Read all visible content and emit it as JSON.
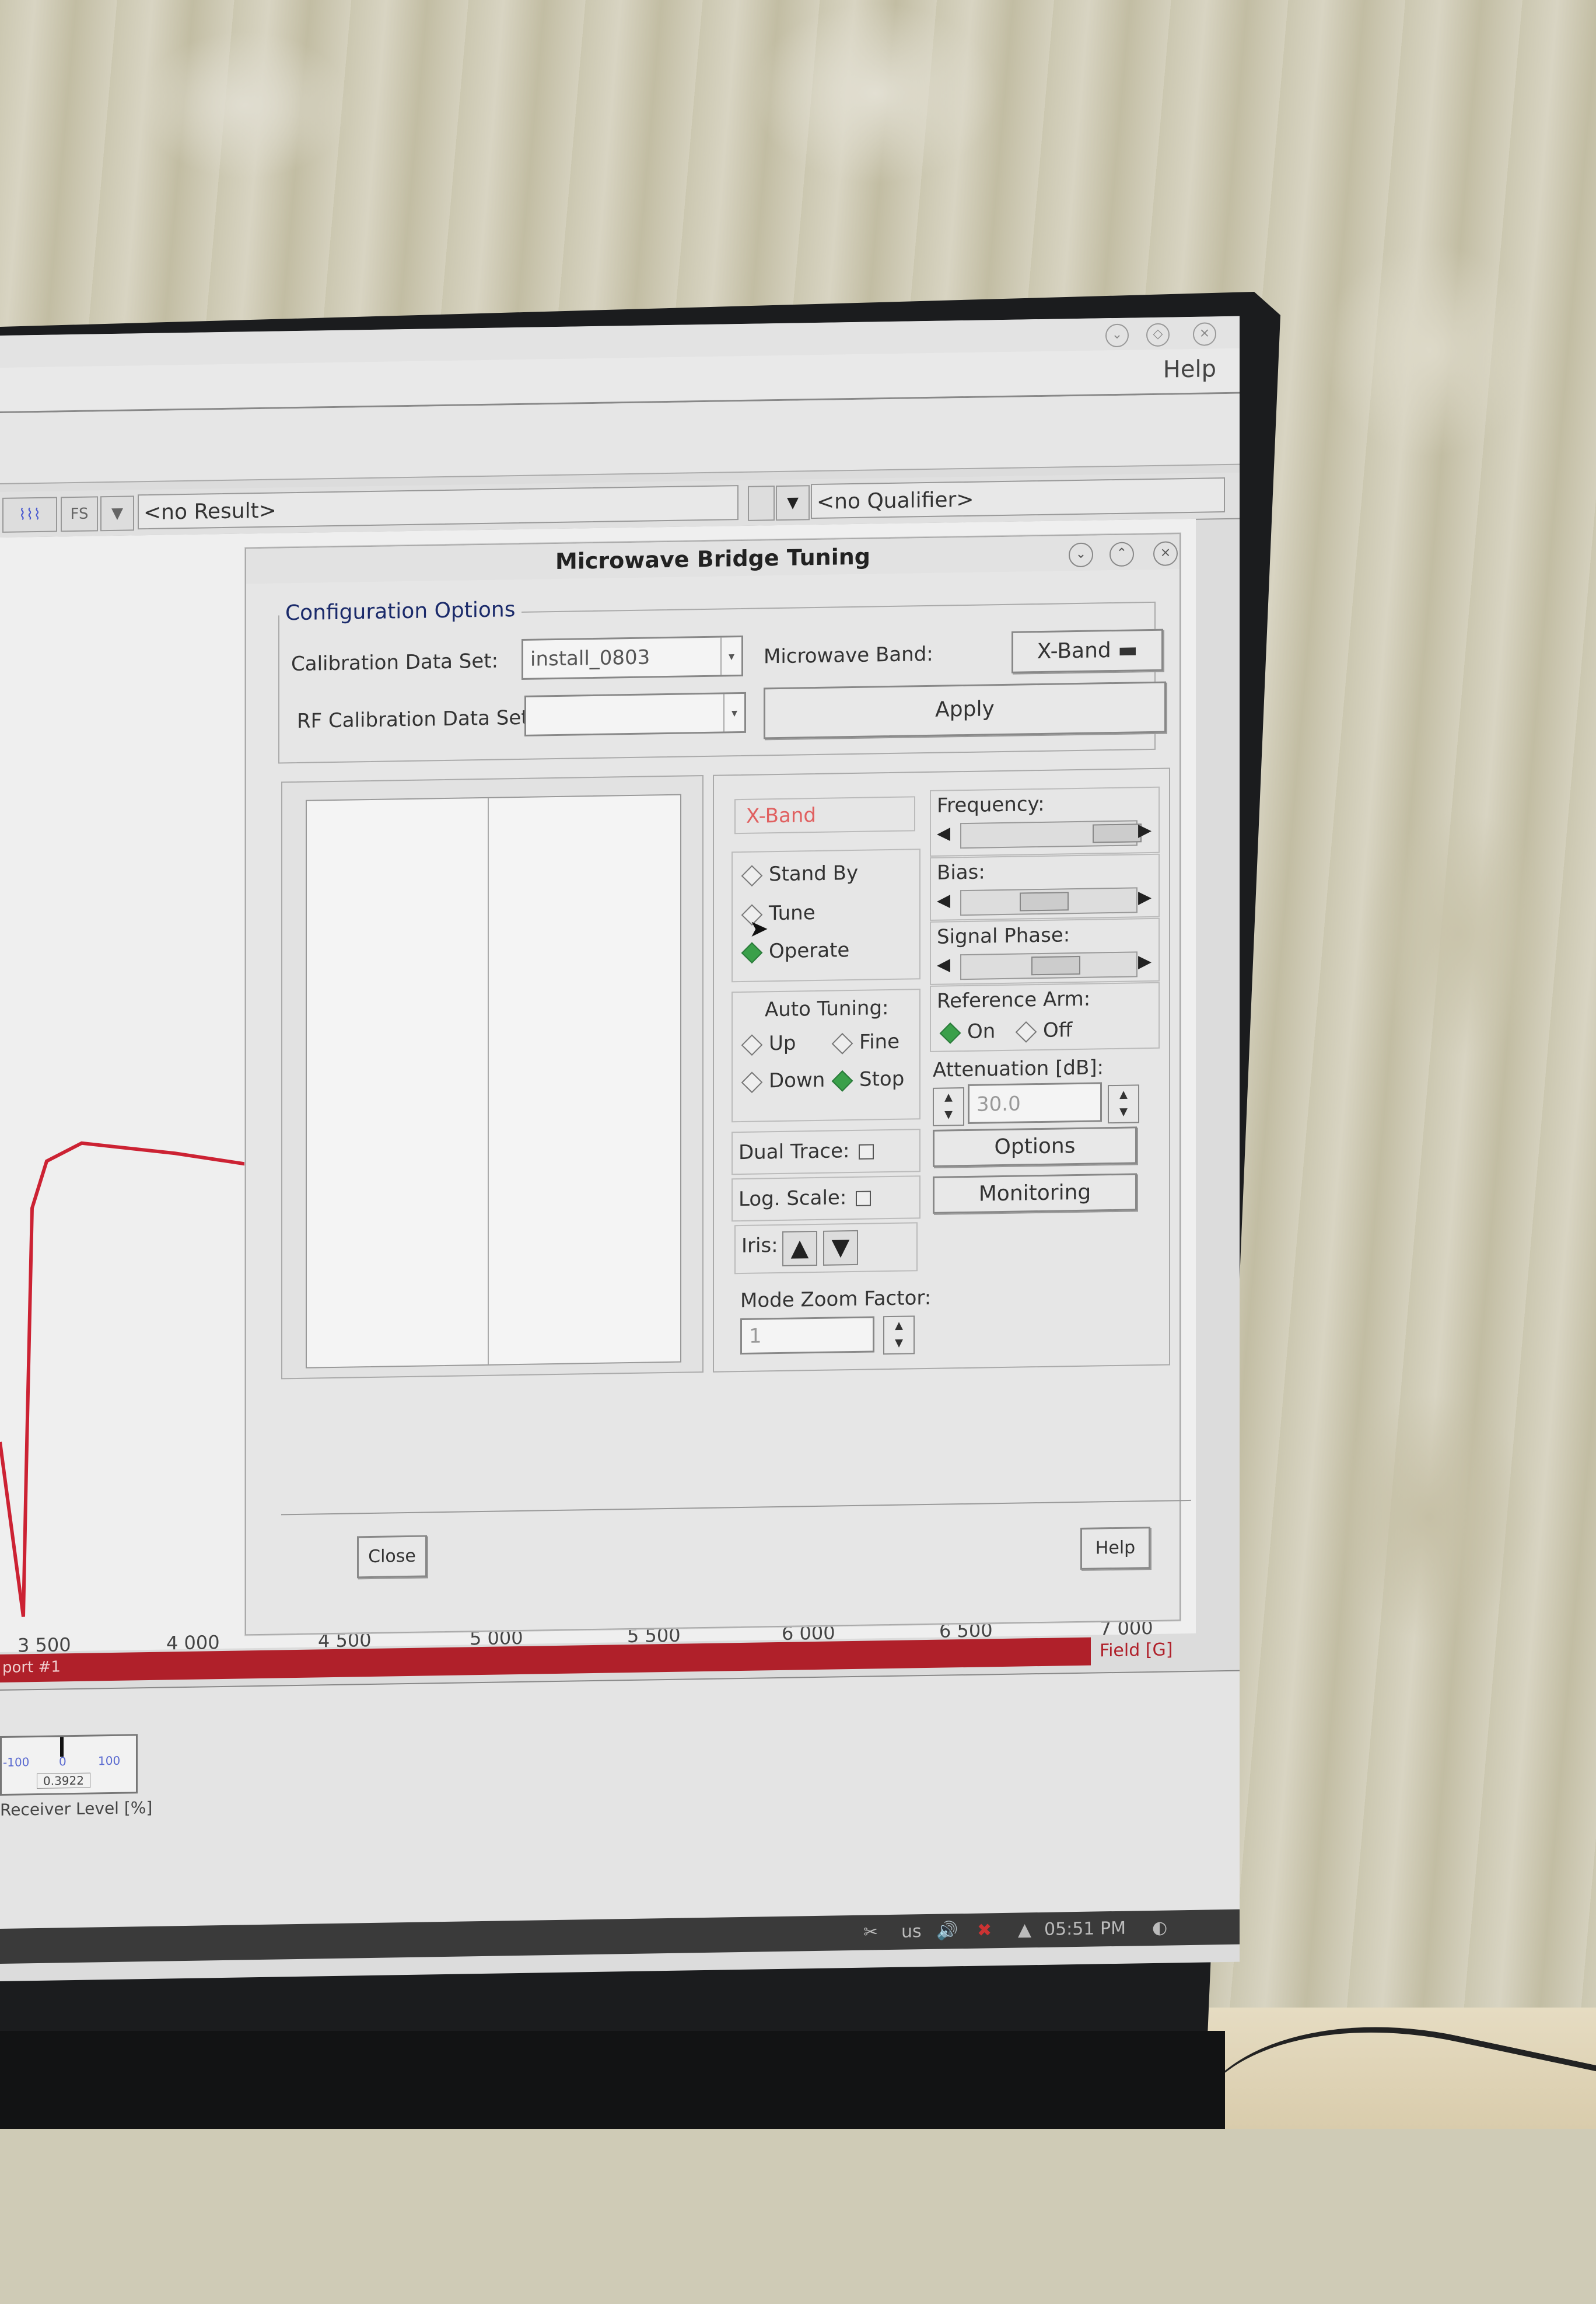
{
  "app": {
    "menu_help": "Help",
    "result_combo": "<no Result>",
    "qualifier_combo": "<no Qualifier>",
    "toolbar_icons": [
      "waveform-icon",
      "fs-icon",
      "filter-icon"
    ],
    "fs_label": "FS"
  },
  "plot": {
    "x_ticks": [
      "3 500",
      "4 000",
      "4 500",
      "5 000",
      "5 500",
      "6 000",
      "6 500",
      "7 000"
    ],
    "x_label": "Field [G]",
    "viewport_label": "port #1"
  },
  "meter": {
    "min": "-100",
    "mid": "0",
    "max": "100",
    "value": "0.3922",
    "label": "Receiver Level [%]"
  },
  "taskbar": {
    "keyboard": "us",
    "time": "05:51 PM"
  },
  "dialog": {
    "title": "Microwave Bridge Tuning",
    "config_group": "Configuration Options",
    "calibration_label": "Calibration Data Set:",
    "calibration_value": "install_0803",
    "rf_calibration_label": "RF Calibration Data Set:",
    "rf_calibration_value": "",
    "band_label": "Microwave Band:",
    "band_value": "X-Band",
    "apply": "Apply",
    "band_indicator": "X-Band",
    "modes": [
      {
        "label": "Stand By",
        "selected": false
      },
      {
        "label": "Tune",
        "selected": false
      },
      {
        "label": "Operate",
        "selected": true
      }
    ],
    "auto_tuning_label": "Auto Tuning:",
    "auto_up": "Up",
    "auto_fine": "Fine",
    "auto_down": "Down",
    "auto_stop": "Stop",
    "auto_selected": "Stop",
    "frequency_label": "Frequency:",
    "frequency_level": 0.85,
    "bias_label": "Bias:",
    "bias_level": 0.45,
    "phase_label": "Signal Phase:",
    "phase_level": 0.5,
    "ref_arm_label": "Reference Arm:",
    "ref_on": "On",
    "ref_off": "Off",
    "ref_selected": "On",
    "attenuation_label": "Attenuation [dB]:",
    "attenuation_value": "30.0",
    "dual_trace": "Dual Trace:",
    "log_scale": "Log. Scale:",
    "options": "Options",
    "monitoring": "Monitoring",
    "iris": "Iris:",
    "mode_zoom_label": "Mode Zoom Factor:",
    "mode_zoom_value": "1",
    "close": "Close",
    "help": "Help"
  }
}
